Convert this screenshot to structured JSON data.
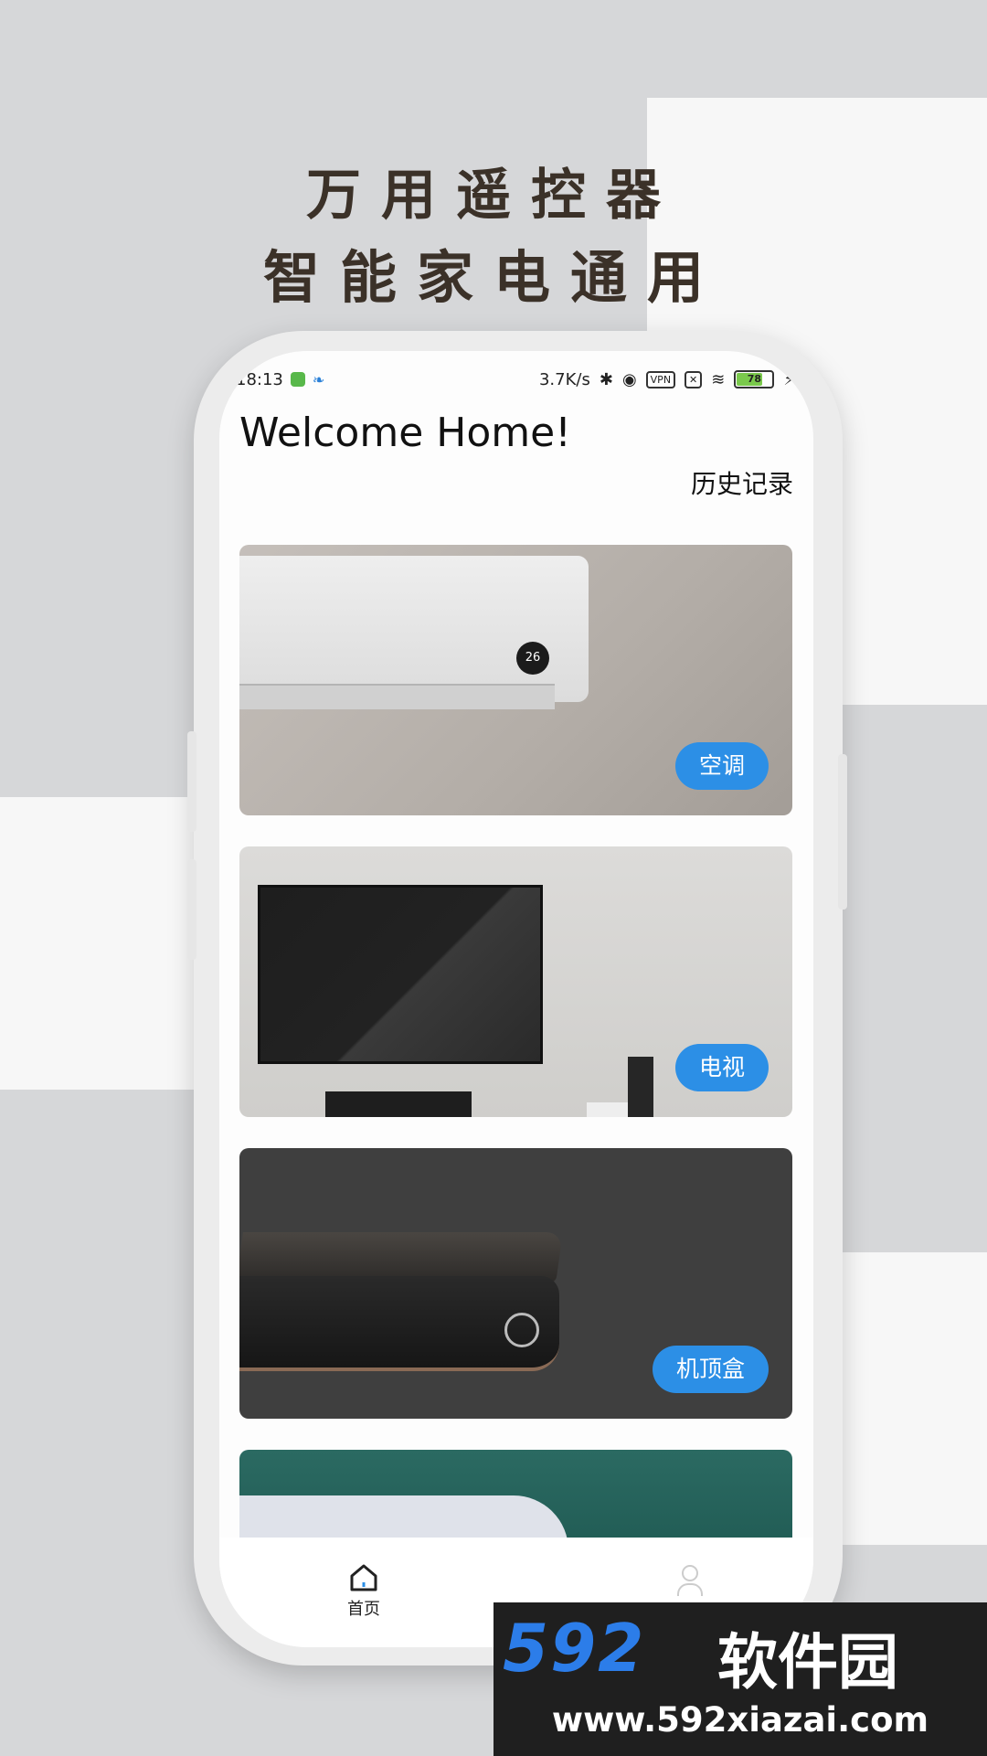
{
  "promo": {
    "line1": "万用遥控器",
    "line2": "智能家电通用"
  },
  "status_bar": {
    "time": "18:13",
    "net_speed": "3.7K/s",
    "vpn": "VPN",
    "battery": "78"
  },
  "app": {
    "greeting": "Welcome Home!",
    "history_label": "历史记录",
    "devices": [
      {
        "label": "空调"
      },
      {
        "label": "电视"
      },
      {
        "label": "机顶盒"
      }
    ],
    "tabbar": {
      "home_label": "首页"
    }
  },
  "watermark": {
    "number": "592",
    "brand": "软件园",
    "site": "www.592xiazai.com"
  },
  "colors": {
    "accent": "#2c8fe6",
    "headline": "#3b3128",
    "background": "#d6d7d9"
  }
}
